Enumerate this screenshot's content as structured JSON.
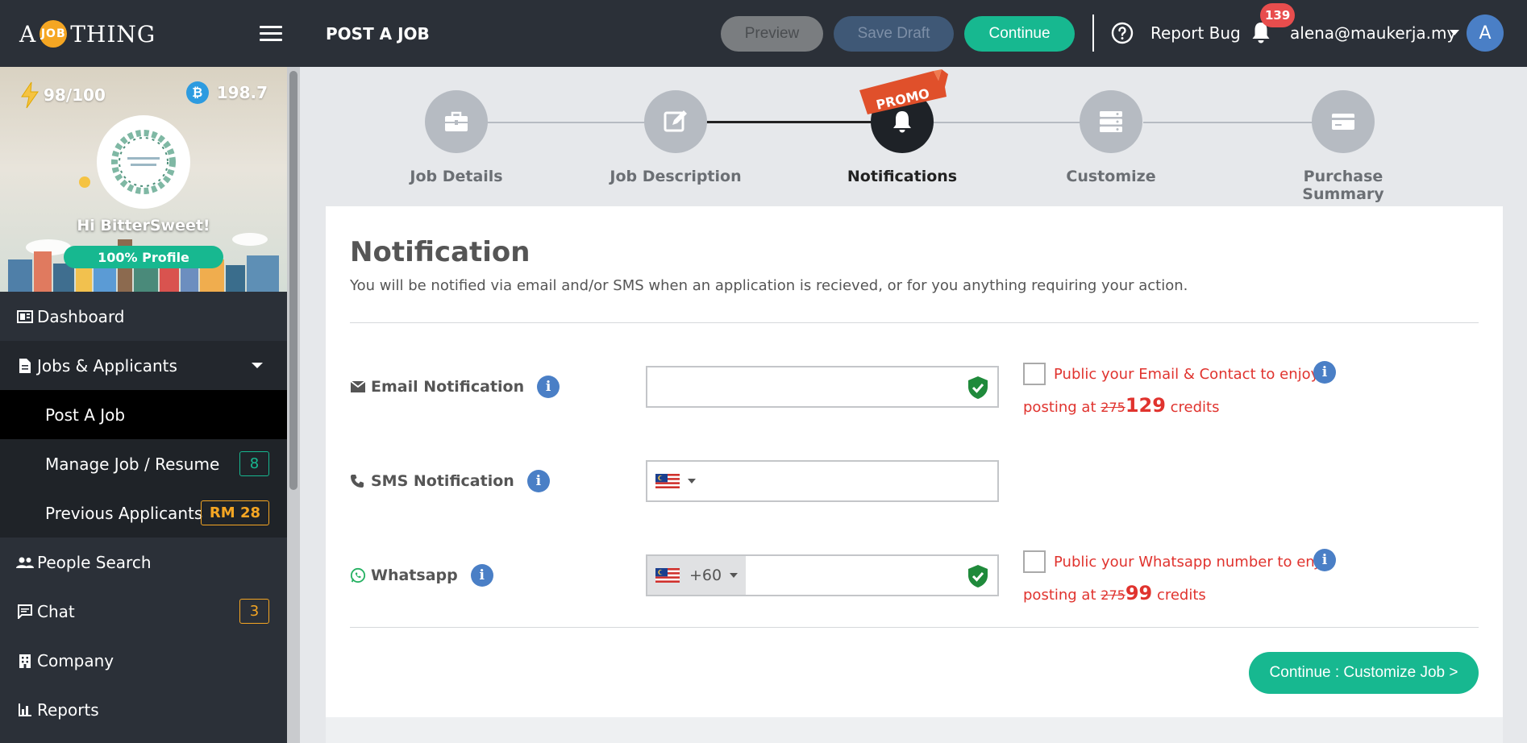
{
  "header": {
    "logo_left": "A",
    "logo_badge": "JOB",
    "logo_right": "THING",
    "page_title": "POST A JOB",
    "preview_label": "Preview",
    "save_draft_label": "Save Draft",
    "continue_label": "Continue",
    "report_bug_label": "Report Bug",
    "notification_count": "139",
    "user_email": "alena@maukerja.my",
    "avatar_letter": "A"
  },
  "sidebar": {
    "energy": "98/100",
    "credits": "198.7",
    "coin_symbol": "₿",
    "greeting": "Hi BitterSweet!",
    "profile_completion": "100% Profile",
    "nav": {
      "dashboard": "Dashboard",
      "jobs_applicants": "Jobs & Applicants",
      "post_a_job": "Post A Job",
      "manage_job": "Manage Job / Resume",
      "manage_job_badge": "8",
      "previous_applicants": "Previous Applicants",
      "previous_applicants_badge": "RM 28",
      "people_search": "People Search",
      "chat": "Chat",
      "chat_badge": "3",
      "company": "Company",
      "reports": "Reports"
    }
  },
  "stepper": {
    "steps": [
      {
        "label": "Job Details",
        "icon": "briefcase-icon"
      },
      {
        "label": "Job Description",
        "icon": "edit-icon"
      },
      {
        "label": "Notifications",
        "icon": "bell-icon"
      },
      {
        "label": "Customize",
        "icon": "server-icon"
      },
      {
        "label": "Purchase Summary",
        "icon": "card-icon"
      }
    ],
    "active_index": 2,
    "promo_label": "PROMO"
  },
  "notification": {
    "title": "Notification",
    "subtitle": "You will be notified via email and/or SMS when an application is recieved, or for you anything requiring your action.",
    "email": {
      "label": "Email Notification",
      "value": "",
      "public_text_1": "Public your Email & Contact to enjoy",
      "public_text_2": "posting at",
      "old_price": "275",
      "new_price": "129",
      "unit": "credits"
    },
    "sms": {
      "label": "SMS Notification",
      "value": ""
    },
    "whatsapp": {
      "label": "Whatsapp",
      "country_code": "+60",
      "value": "",
      "public_text_1": "Public your Whatsapp number to enjoy",
      "public_text_2": "posting at",
      "old_price": "275",
      "new_price": "99",
      "unit": "credits"
    },
    "continue_button": "Continue : Customize Job >"
  },
  "colors": {
    "header_bg": "#2b3038",
    "accent_green": "#17b890",
    "badge_orange": "#f5a623",
    "promo_red": "#e0332e",
    "info_blue": "#4a7fc6"
  }
}
